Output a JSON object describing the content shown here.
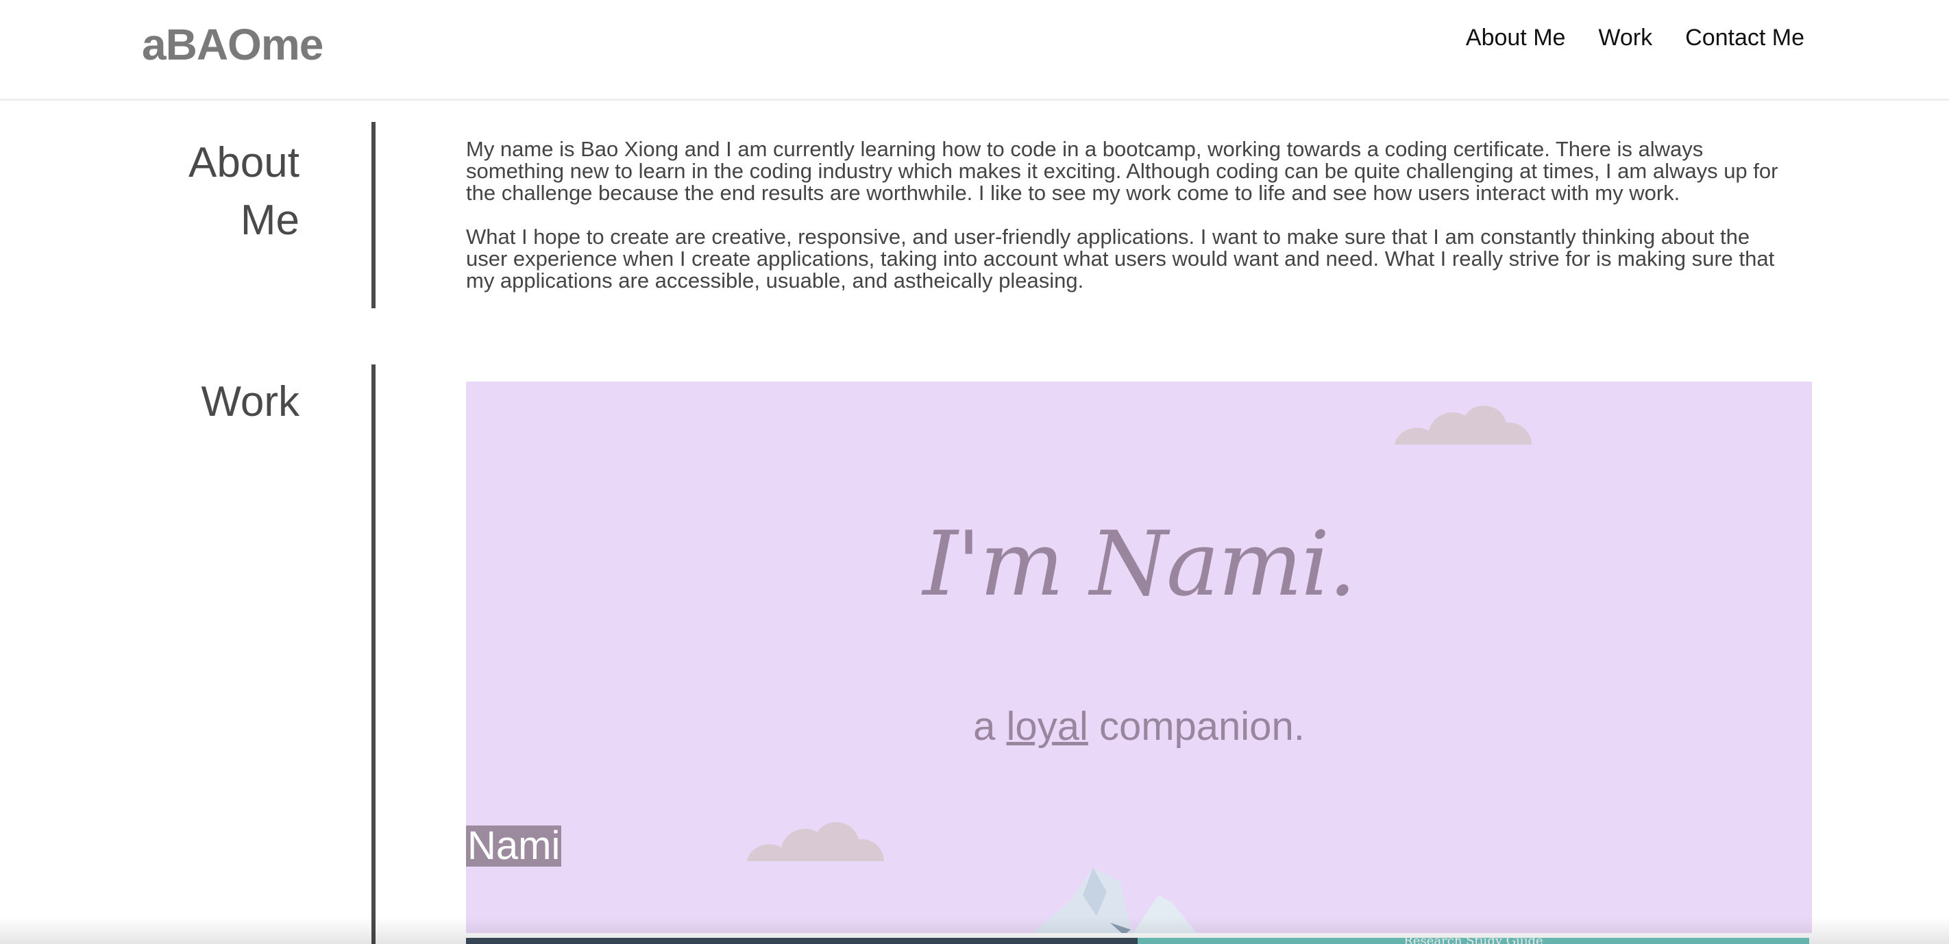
{
  "header": {
    "logo": "aBAOme",
    "nav": [
      "About Me",
      "Work",
      "Contact Me"
    ]
  },
  "about": {
    "title_line1": "About",
    "title_line2": "Me",
    "paragraphs": [
      "My name is Bao Xiong and I am currently learning how to code in a bootcamp, working towards a coding certificate. There is always something new to learn in the coding industry which makes it exciting. Although coding can be quite challenging at times, I am always up for the challenge because the end results are worthwhile. I like to see my work come to life and see how users interact with my work.",
      "What I hope to create are creative, responsive, and user-friendly applications. I want to make sure that I am constantly thinking about the user experience when I create applications, taking into account what users would want and need. What I really strive for is making sure that my applications are accessible, usuable, and astheically pleasing."
    ]
  },
  "work": {
    "title": "Work",
    "projects": [
      {
        "hero_title": "I'm Nami.",
        "hero_sub_prefix": "a ",
        "hero_sub_underlined": "loyal",
        "hero_sub_suffix": " companion.",
        "label": "Nami",
        "background": "#e9d8f7"
      },
      {
        "caption": "Research Study Guide"
      }
    ]
  },
  "colors": {
    "accent_text": "#9a859f",
    "divider": "#4a4a4a",
    "cloud": "#d9c9d3"
  }
}
